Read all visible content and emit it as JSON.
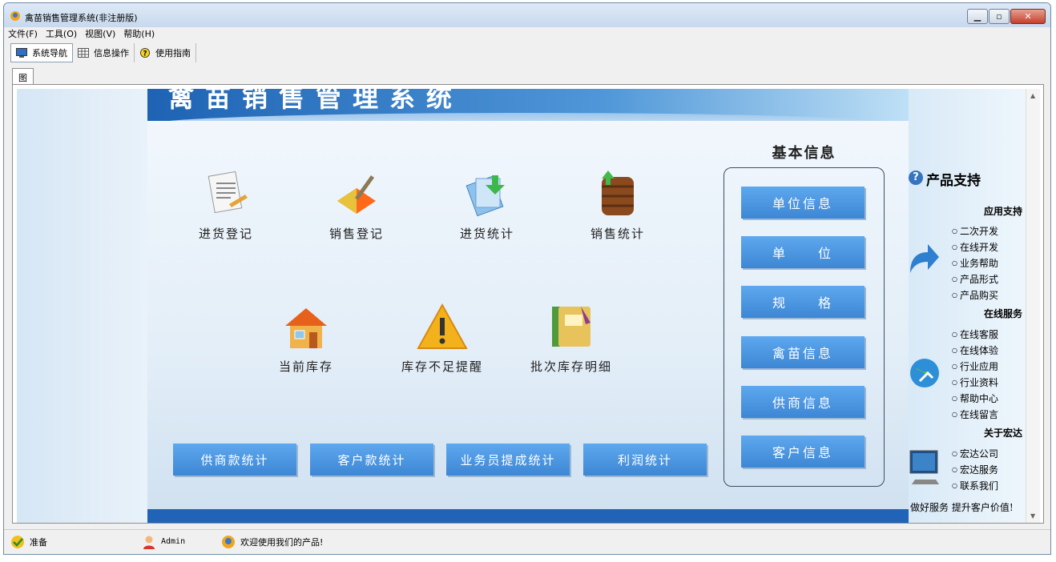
{
  "window": {
    "title": "禽苗销售管理系统(非注册版)"
  },
  "menu": [
    "文件(F)",
    "工具(O)",
    "视图(V)",
    "帮助(H)"
  ],
  "toolbar": {
    "nav": "系统导航",
    "info": "信息操作",
    "guide": "使用指南"
  },
  "tab": {
    "label": "图文导航"
  },
  "banner": {
    "title": "禽苗销售管理系统"
  },
  "nav": {
    "row1": [
      "进货登记",
      "销售登记",
      "进货统计",
      "销售统计"
    ],
    "row2": [
      "当前库存",
      "库存不足提醒",
      "批次库存明细"
    ]
  },
  "stats": [
    "供商款统计",
    "客户款统计",
    "业务员提成统计",
    "利润统计"
  ],
  "basic": {
    "title": "基本信息",
    "buttons": [
      "单位信息",
      "单　　位",
      "规　　格",
      "禽苗信息",
      "供商信息",
      "客户信息"
    ]
  },
  "support": {
    "title": "产品支持",
    "sections": [
      {
        "title": "应用支持",
        "links": [
          "二次开发",
          "在线开发",
          "业务帮助",
          "产品形式",
          "产品购买"
        ]
      },
      {
        "title": "在线服务",
        "links": [
          "在线客服",
          "在线体验",
          "行业应用",
          "行业资料",
          "帮助中心",
          "在线留言"
        ]
      },
      {
        "title": "关于宏达",
        "links": [
          "宏达公司",
          "宏达服务",
          "联系我们"
        ]
      }
    ],
    "slogan": "做好服务 提升客户价值!"
  },
  "status": {
    "ready": "准备",
    "user": "Admin",
    "welcome": "欢迎使用我们的产品!"
  },
  "colors": {
    "accent": "#3d86d4",
    "banner": "#1e63b4"
  }
}
